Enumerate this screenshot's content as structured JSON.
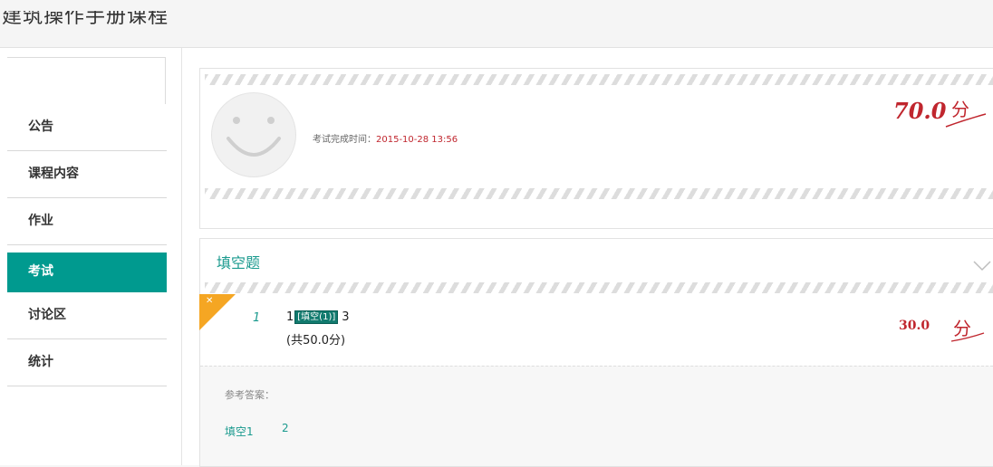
{
  "header": {
    "title": "建筑操作手册课程"
  },
  "sidebar": {
    "items": [
      {
        "label": "公告"
      },
      {
        "label": "课程内容"
      },
      {
        "label": "作业"
      },
      {
        "label": "考试"
      },
      {
        "label": "讨论区"
      },
      {
        "label": "统计"
      }
    ],
    "active_index": 3
  },
  "result": {
    "finish_label": "考试完成时间：",
    "finish_time": "2015-10-28 13:56",
    "total_score": "70.0",
    "score_unit": "分"
  },
  "section": {
    "title": "填空题",
    "question": {
      "number": "1",
      "text_before": "1",
      "blank_tag": "[填空(1)]",
      "text_after": "3",
      "points": "(共50.0分)",
      "score": "30.0",
      "score_unit": "分",
      "reference_label": "参考答案：",
      "blank_label": "填空1",
      "blank_answer": "2"
    }
  },
  "colors": {
    "accent": "#009a8f",
    "score_red": "#c0262e",
    "flag_orange": "#f5a623"
  }
}
